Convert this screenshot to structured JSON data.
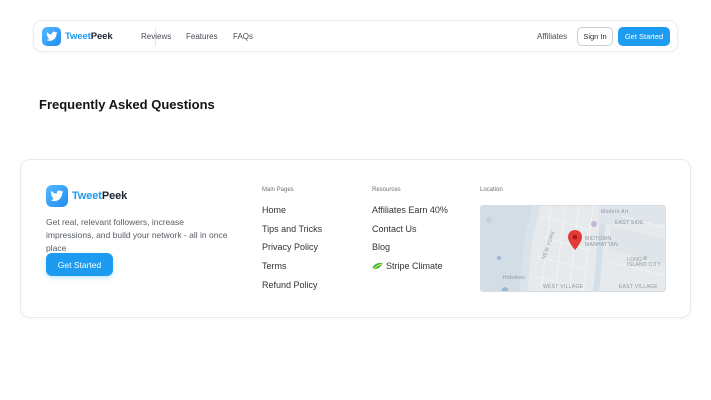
{
  "brand": {
    "name_part1": "Tweet",
    "name_part2": "Peek"
  },
  "nav": {
    "links": [
      "Reviews",
      "Features",
      "FAQs"
    ],
    "affiliates": "Affiliates",
    "signin": "Sign In",
    "get_started": "Get Started"
  },
  "faq": {
    "title": "Frequently Asked Questions"
  },
  "footer": {
    "description": "Get real, relevant followers, increase impressions, and build your network - all in once place",
    "get_started": "Get Started",
    "main_pages": {
      "heading": "Main Pages",
      "links": [
        "Home",
        "Tips and Tricks",
        "Privacy Policy",
        "Terms",
        "Refund Policy"
      ]
    },
    "resources": {
      "heading": "Resources",
      "links": [
        "Affiliates Earn 40%",
        "Contact Us",
        "Blog",
        "Stripe Climate"
      ]
    },
    "location": {
      "heading": "Location",
      "map_labels": [
        "Modern Art",
        "EAST SIDE",
        "MIDTOWN",
        "MANHATTAN",
        "LONG ISLAND CITY",
        "Hoboken",
        "NEW YORK",
        "WEST VILLAGE",
        "EAST VILLAGE"
      ]
    }
  },
  "colors": {
    "accent": "#1d9bf0",
    "map_pin": "#e53935"
  },
  "icons": {
    "logo": "bird-logo-icon",
    "leaf": "stripe-climate-leaf-icon",
    "pin": "map-pin-icon"
  }
}
